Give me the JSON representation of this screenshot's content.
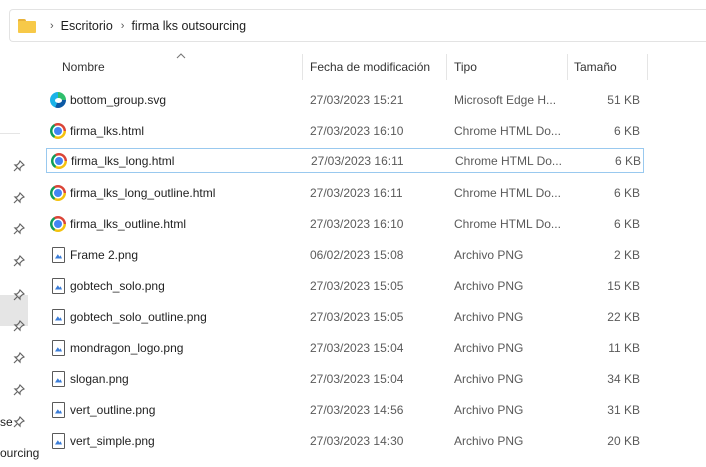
{
  "address": {
    "folder_icon": "folder-icon",
    "crumbs": [
      "Escritorio",
      "firma lks outsourcing"
    ],
    "separator": "›"
  },
  "nav": {
    "partial_labels": [
      "se",
      "ourcing"
    ]
  },
  "columns": {
    "name": "Nombre",
    "date": "Fecha de modificación",
    "type": "Tipo",
    "size": "Tamaño"
  },
  "files": [
    {
      "name": "bottom_group.svg",
      "date": "27/03/2023 15:21",
      "type": "Microsoft Edge H...",
      "size": "51 KB",
      "icon": "edge-icon"
    },
    {
      "name": "firma_lks.html",
      "date": "27/03/2023 16:10",
      "type": "Chrome HTML Do...",
      "size": "6 KB",
      "icon": "chrome-icon"
    },
    {
      "name": "firma_lks_long.html",
      "date": "27/03/2023 16:11",
      "type": "Chrome HTML Do...",
      "size": "6 KB",
      "icon": "chrome-icon",
      "selected": true
    },
    {
      "name": "firma_lks_long_outline.html",
      "date": "27/03/2023 16:11",
      "type": "Chrome HTML Do...",
      "size": "6 KB",
      "icon": "chrome-icon"
    },
    {
      "name": "firma_lks_outline.html",
      "date": "27/03/2023 16:10",
      "type": "Chrome HTML Do...",
      "size": "6 KB",
      "icon": "chrome-icon"
    },
    {
      "name": "Frame 2.png",
      "date": "06/02/2023 15:08",
      "type": "Archivo PNG",
      "size": "2 KB",
      "icon": "png-icon"
    },
    {
      "name": "gobtech_solo.png",
      "date": "27/03/2023 15:05",
      "type": "Archivo PNG",
      "size": "15 KB",
      "icon": "png-icon"
    },
    {
      "name": "gobtech_solo_outline.png",
      "date": "27/03/2023 15:05",
      "type": "Archivo PNG",
      "size": "22 KB",
      "icon": "png-icon"
    },
    {
      "name": "mondragon_logo.png",
      "date": "27/03/2023 15:04",
      "type": "Archivo PNG",
      "size": "11 KB",
      "icon": "png-icon"
    },
    {
      "name": "slogan.png",
      "date": "27/03/2023 15:04",
      "type": "Archivo PNG",
      "size": "34 KB",
      "icon": "png-icon"
    },
    {
      "name": "vert_outline.png",
      "date": "27/03/2023 14:56",
      "type": "Archivo PNG",
      "size": "31 KB",
      "icon": "png-icon"
    },
    {
      "name": "vert_simple.png",
      "date": "27/03/2023 14:30",
      "type": "Archivo PNG",
      "size": "20 KB",
      "icon": "png-icon"
    }
  ]
}
